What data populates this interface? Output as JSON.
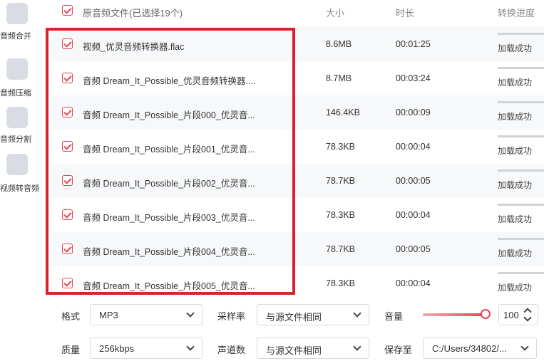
{
  "sidebar": {
    "items": [
      {
        "label": "音频合并",
        "icon": "merge-icon"
      },
      {
        "label": "音频压缩",
        "icon": "compress-icon"
      },
      {
        "label": "音频分割",
        "icon": "split-icon"
      },
      {
        "label": "视频转音频",
        "icon": "video-to-audio-icon"
      }
    ]
  },
  "table": {
    "headers": {
      "select_all_label": "原音频文件(已选择19个)",
      "size": "大小",
      "duration": "时长",
      "progress": "转换进度"
    },
    "rows": [
      {
        "name": "视频_优灵音频转换器.flac",
        "size": "8.6MB",
        "duration": "00:01:25",
        "status": "加载成功"
      },
      {
        "name": "音频 Dream_It_Possible_优灵音频转换器....",
        "size": "8.7MB",
        "duration": "00:03:24",
        "status": "加载成功"
      },
      {
        "name": "音频 Dream_It_Possible_片段000_优灵音...",
        "size": "146.4KB",
        "duration": "00:00:09",
        "status": "加载成功"
      },
      {
        "name": "音频 Dream_It_Possible_片段001_优灵音...",
        "size": "78.3KB",
        "duration": "00:00:04",
        "status": "加载成功"
      },
      {
        "name": "音频 Dream_It_Possible_片段002_优灵音...",
        "size": "78.7KB",
        "duration": "00:00:05",
        "status": "加载成功"
      },
      {
        "name": "音频 Dream_It_Possible_片段003_优灵音...",
        "size": "78.3KB",
        "duration": "00:00:04",
        "status": "加载成功"
      },
      {
        "name": "音频 Dream_It_Possible_片段004_优灵音...",
        "size": "78.7KB",
        "duration": "00:00:05",
        "status": "加载成功"
      },
      {
        "name": "音频 Dream_It_Possible_片段005_优灵音...",
        "size": "78.3KB",
        "duration": "00:00:04",
        "status": "加载成功"
      }
    ]
  },
  "settings": {
    "format_label": "格式",
    "format_value": "MP3",
    "sample_rate_label": "采样率",
    "sample_rate_value": "与源文件相同",
    "volume_label": "音量",
    "volume_value": "100",
    "quality_label": "质量",
    "quality_value": "256kbps",
    "channels_label": "声道数",
    "channels_value": "与源文件相同",
    "save_label": "保存至",
    "save_value": "C:/Users/34802/..."
  },
  "colors": {
    "accent": "#e8434f",
    "highlight_border": "#d8242c"
  }
}
